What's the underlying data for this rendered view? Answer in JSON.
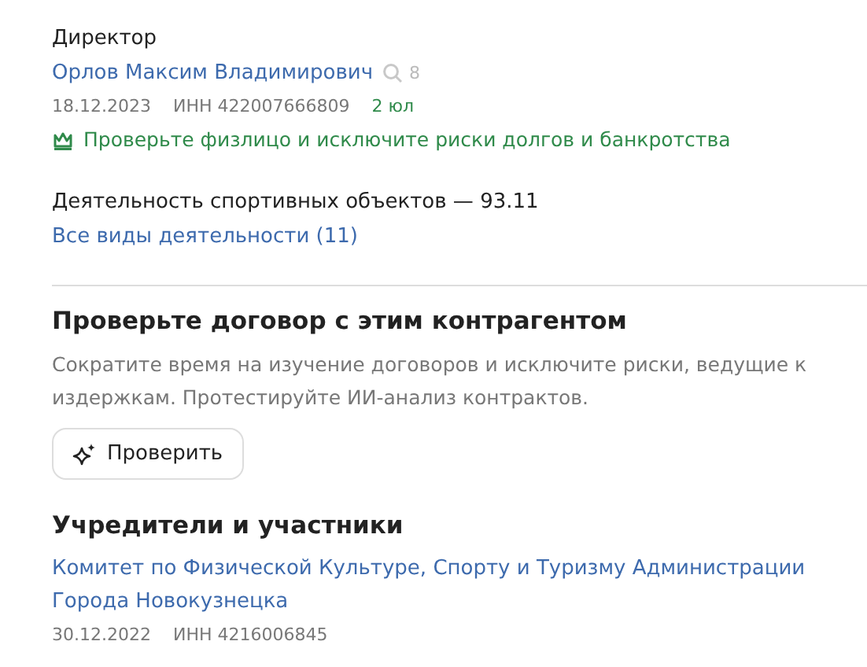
{
  "director": {
    "label": "Директор",
    "name": "Орлов Максим Владимирович",
    "search_count": "8",
    "date": "18.12.2023",
    "inn": "ИНН 422007666809",
    "related": "2 юл",
    "promo": "Проверьте физлицо и исключите риски долгов и банкротства"
  },
  "activity": {
    "main": "Деятельность спортивных объектов — 93.11",
    "all_link": "Все виды деятельности (11)"
  },
  "contract_check": {
    "title": "Проверьте договор с этим контрагентом",
    "description": "Сократите время на изучение договоров и исключите риски, ведущие к издержкам. Протестируйте ИИ-анализ контрактов.",
    "button": "Проверить"
  },
  "founders": {
    "title": "Учредители и участники",
    "items": [
      {
        "name": "Комитет по Физической Культуре, Спорту и Туризму Администрации Города Новокузнецка",
        "date": "30.12.2022",
        "inn": "ИНН 4216006845"
      }
    ]
  }
}
